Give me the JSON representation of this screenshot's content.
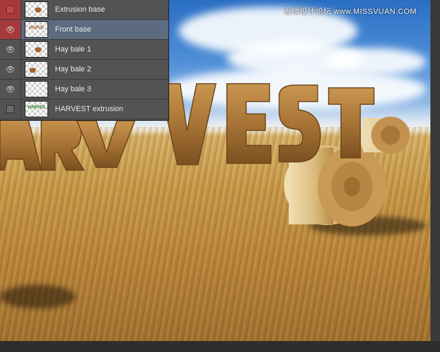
{
  "watermark": "思缘设计论坛 www.MISSVUAN.COM",
  "canvas": {
    "artwork_text": "HARVEST",
    "colors": {
      "sky": "#2b6fc4",
      "field": "#c89a4a",
      "hay": "#b88a3e"
    }
  },
  "layers_panel": {
    "layers": [
      {
        "name": "Extrusion base",
        "visible": false,
        "active": false,
        "thumb": "hay-icon"
      },
      {
        "name": "Front base",
        "visible": true,
        "active": true,
        "thumb": "harvest-text-thumb",
        "thumb_text": "HARVE"
      },
      {
        "name": "Hay bale 1",
        "visible": true,
        "active": false,
        "thumb": "hay-icon"
      },
      {
        "name": "Hay bale 2",
        "visible": true,
        "active": false,
        "thumb": "hay-icon"
      },
      {
        "name": "Hay bale 3",
        "visible": true,
        "active": false,
        "thumb": "checker-icon"
      },
      {
        "name": "HARVEST extrusion",
        "visible": false,
        "active": false,
        "thumb": "harvest-text-thumb",
        "thumb_text": "HARVES"
      }
    ]
  }
}
